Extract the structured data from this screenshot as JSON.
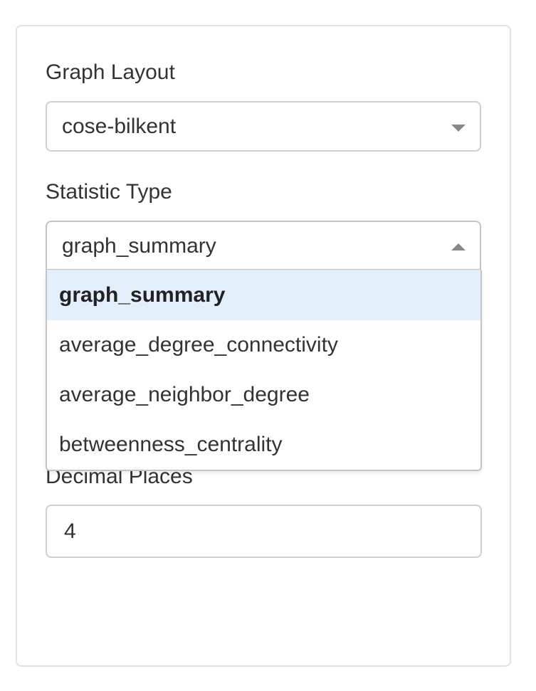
{
  "graph_layout": {
    "label": "Graph Layout",
    "value": "cose-bilkent"
  },
  "statistic_type": {
    "label": "Statistic Type",
    "value": "graph_summary",
    "options": [
      "graph_summary",
      "average_degree_connectivity",
      "average_neighbor_degree",
      "betweenness_centrality"
    ]
  },
  "decimal_places": {
    "label": "Decimal Places",
    "value": "4"
  },
  "icons": {
    "layout_caret": "chevron-down-icon",
    "statistic_caret": "chevron-up-icon"
  }
}
